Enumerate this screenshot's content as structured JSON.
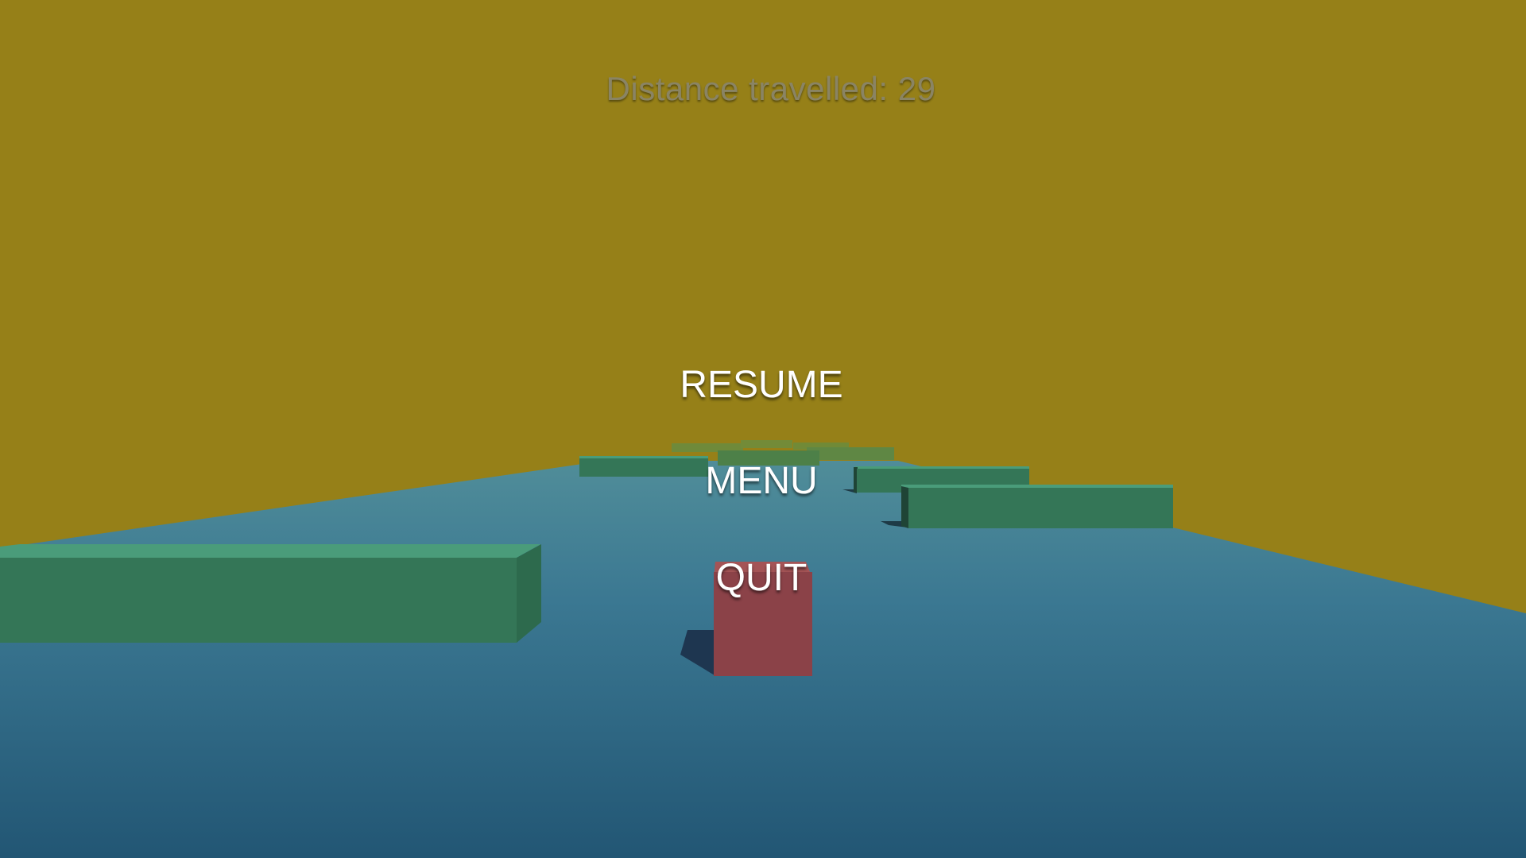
{
  "hud": {
    "distance_label": "Distance travelled: 29"
  },
  "pause_menu": {
    "resume_label": "RESUME",
    "menu_label": "MENU",
    "quit_label": "QUIT"
  },
  "colors": {
    "sky": "#968018",
    "floor_far": "#4f8b98",
    "floor_near": "#245a78",
    "obstacle": "#347657",
    "obstacle_top": "#4a9c7a",
    "player": "#8b4248",
    "player_top": "#a55556"
  }
}
